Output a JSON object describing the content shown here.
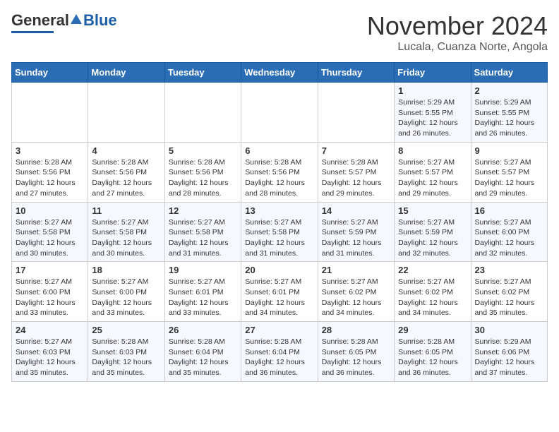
{
  "header": {
    "logo_general": "General",
    "logo_blue": "Blue",
    "title": "November 2024",
    "subtitle": "Lucala, Cuanza Norte, Angola"
  },
  "calendar": {
    "days_of_week": [
      "Sunday",
      "Monday",
      "Tuesday",
      "Wednesday",
      "Thursday",
      "Friday",
      "Saturday"
    ],
    "weeks": [
      [
        {
          "day": "",
          "info": ""
        },
        {
          "day": "",
          "info": ""
        },
        {
          "day": "",
          "info": ""
        },
        {
          "day": "",
          "info": ""
        },
        {
          "day": "",
          "info": ""
        },
        {
          "day": "1",
          "info": "Sunrise: 5:29 AM\nSunset: 5:55 PM\nDaylight: 12 hours and 26 minutes."
        },
        {
          "day": "2",
          "info": "Sunrise: 5:29 AM\nSunset: 5:55 PM\nDaylight: 12 hours and 26 minutes."
        }
      ],
      [
        {
          "day": "3",
          "info": "Sunrise: 5:28 AM\nSunset: 5:56 PM\nDaylight: 12 hours and 27 minutes."
        },
        {
          "day": "4",
          "info": "Sunrise: 5:28 AM\nSunset: 5:56 PM\nDaylight: 12 hours and 27 minutes."
        },
        {
          "day": "5",
          "info": "Sunrise: 5:28 AM\nSunset: 5:56 PM\nDaylight: 12 hours and 28 minutes."
        },
        {
          "day": "6",
          "info": "Sunrise: 5:28 AM\nSunset: 5:56 PM\nDaylight: 12 hours and 28 minutes."
        },
        {
          "day": "7",
          "info": "Sunrise: 5:28 AM\nSunset: 5:57 PM\nDaylight: 12 hours and 29 minutes."
        },
        {
          "day": "8",
          "info": "Sunrise: 5:27 AM\nSunset: 5:57 PM\nDaylight: 12 hours and 29 minutes."
        },
        {
          "day": "9",
          "info": "Sunrise: 5:27 AM\nSunset: 5:57 PM\nDaylight: 12 hours and 29 minutes."
        }
      ],
      [
        {
          "day": "10",
          "info": "Sunrise: 5:27 AM\nSunset: 5:58 PM\nDaylight: 12 hours and 30 minutes."
        },
        {
          "day": "11",
          "info": "Sunrise: 5:27 AM\nSunset: 5:58 PM\nDaylight: 12 hours and 30 minutes."
        },
        {
          "day": "12",
          "info": "Sunrise: 5:27 AM\nSunset: 5:58 PM\nDaylight: 12 hours and 31 minutes."
        },
        {
          "day": "13",
          "info": "Sunrise: 5:27 AM\nSunset: 5:58 PM\nDaylight: 12 hours and 31 minutes."
        },
        {
          "day": "14",
          "info": "Sunrise: 5:27 AM\nSunset: 5:59 PM\nDaylight: 12 hours and 31 minutes."
        },
        {
          "day": "15",
          "info": "Sunrise: 5:27 AM\nSunset: 5:59 PM\nDaylight: 12 hours and 32 minutes."
        },
        {
          "day": "16",
          "info": "Sunrise: 5:27 AM\nSunset: 6:00 PM\nDaylight: 12 hours and 32 minutes."
        }
      ],
      [
        {
          "day": "17",
          "info": "Sunrise: 5:27 AM\nSunset: 6:00 PM\nDaylight: 12 hours and 33 minutes."
        },
        {
          "day": "18",
          "info": "Sunrise: 5:27 AM\nSunset: 6:00 PM\nDaylight: 12 hours and 33 minutes."
        },
        {
          "day": "19",
          "info": "Sunrise: 5:27 AM\nSunset: 6:01 PM\nDaylight: 12 hours and 33 minutes."
        },
        {
          "day": "20",
          "info": "Sunrise: 5:27 AM\nSunset: 6:01 PM\nDaylight: 12 hours and 34 minutes."
        },
        {
          "day": "21",
          "info": "Sunrise: 5:27 AM\nSunset: 6:02 PM\nDaylight: 12 hours and 34 minutes."
        },
        {
          "day": "22",
          "info": "Sunrise: 5:27 AM\nSunset: 6:02 PM\nDaylight: 12 hours and 34 minutes."
        },
        {
          "day": "23",
          "info": "Sunrise: 5:27 AM\nSunset: 6:02 PM\nDaylight: 12 hours and 35 minutes."
        }
      ],
      [
        {
          "day": "24",
          "info": "Sunrise: 5:27 AM\nSunset: 6:03 PM\nDaylight: 12 hours and 35 minutes."
        },
        {
          "day": "25",
          "info": "Sunrise: 5:28 AM\nSunset: 6:03 PM\nDaylight: 12 hours and 35 minutes."
        },
        {
          "day": "26",
          "info": "Sunrise: 5:28 AM\nSunset: 6:04 PM\nDaylight: 12 hours and 35 minutes."
        },
        {
          "day": "27",
          "info": "Sunrise: 5:28 AM\nSunset: 6:04 PM\nDaylight: 12 hours and 36 minutes."
        },
        {
          "day": "28",
          "info": "Sunrise: 5:28 AM\nSunset: 6:05 PM\nDaylight: 12 hours and 36 minutes."
        },
        {
          "day": "29",
          "info": "Sunrise: 5:28 AM\nSunset: 6:05 PM\nDaylight: 12 hours and 36 minutes."
        },
        {
          "day": "30",
          "info": "Sunrise: 5:29 AM\nSunset: 6:06 PM\nDaylight: 12 hours and 37 minutes."
        }
      ]
    ]
  }
}
